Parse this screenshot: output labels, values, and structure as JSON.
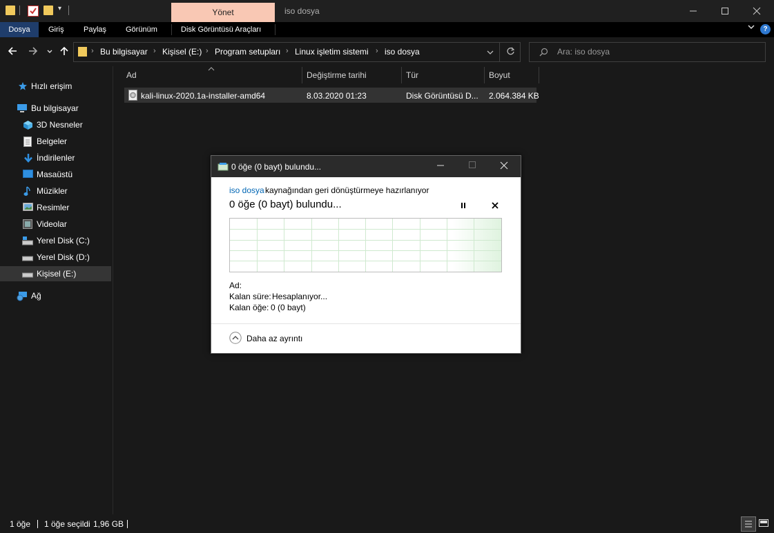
{
  "titlebar": {
    "manage_tab": "Yönet",
    "window_title": "iso dosya"
  },
  "ribbon": {
    "tabs": [
      "Dosya",
      "Giriş",
      "Paylaş",
      "Görünüm",
      "Disk Görüntüsü Araçları"
    ],
    "help": "?"
  },
  "address": {
    "crumbs": [
      "Bu bilgisayar",
      "Kişisel (E:)",
      "Program setupları",
      "Linux işletim sistemi",
      "iso dosya"
    ]
  },
  "search": {
    "placeholder": "Ara: iso dosya"
  },
  "sidebar": {
    "items": [
      {
        "label": "Hızlı erişim",
        "icon": "star-icon"
      },
      {
        "label": "Bu bilgisayar",
        "icon": "computer-icon"
      },
      {
        "label": "3D Nesneler",
        "icon": "cube-icon"
      },
      {
        "label": "Belgeler",
        "icon": "document-icon"
      },
      {
        "label": "İndirilenler",
        "icon": "download-arrow-icon"
      },
      {
        "label": "Masaüstü",
        "icon": "desktop-icon"
      },
      {
        "label": "Müzikler",
        "icon": "music-note-icon"
      },
      {
        "label": "Resimler",
        "icon": "picture-icon"
      },
      {
        "label": "Videolar",
        "icon": "film-icon"
      },
      {
        "label": "Yerel Disk (C:)",
        "icon": "system-drive-icon"
      },
      {
        "label": "Yerel Disk (D:)",
        "icon": "drive-icon"
      },
      {
        "label": "Kişisel (E:)",
        "icon": "drive-icon"
      },
      {
        "label": "Ağ",
        "icon": "network-icon"
      }
    ]
  },
  "columns": {
    "name": "Ad",
    "modified": "Değiştirme tarihi",
    "type": "Tür",
    "size": "Boyut"
  },
  "files": [
    {
      "name": "kali-linux-2020.1a-installer-amd64",
      "modified": "8.03.2020 01:23",
      "type": "Disk Görüntüsü D...",
      "size": "2.064.384 KB"
    }
  ],
  "dialog": {
    "title": "0 öğe (0 bayt) bulundu...",
    "source_link": "iso dosya",
    "preparing_text": "kaynağından geri dönüştürmeye hazırlanıyor",
    "heading": "0 öğe (0 bayt) bulundu...",
    "name_label": "Ad:",
    "time_label": "Kalan süre:",
    "time_value": "Hesaplanıyor...",
    "items_label": "Kalan öğe:",
    "items_value": "0 (0 bayt)",
    "less_details": "Daha az ayrıntı",
    "progress_fraction": 0
  },
  "status": {
    "count": "1 öğe",
    "selected": "1 öğe seçildi",
    "size": "1,96 GB"
  },
  "colors": {
    "accent_tab": "#f9c8b4",
    "file_tab": "#1f3d6b",
    "link": "#0066b4"
  }
}
